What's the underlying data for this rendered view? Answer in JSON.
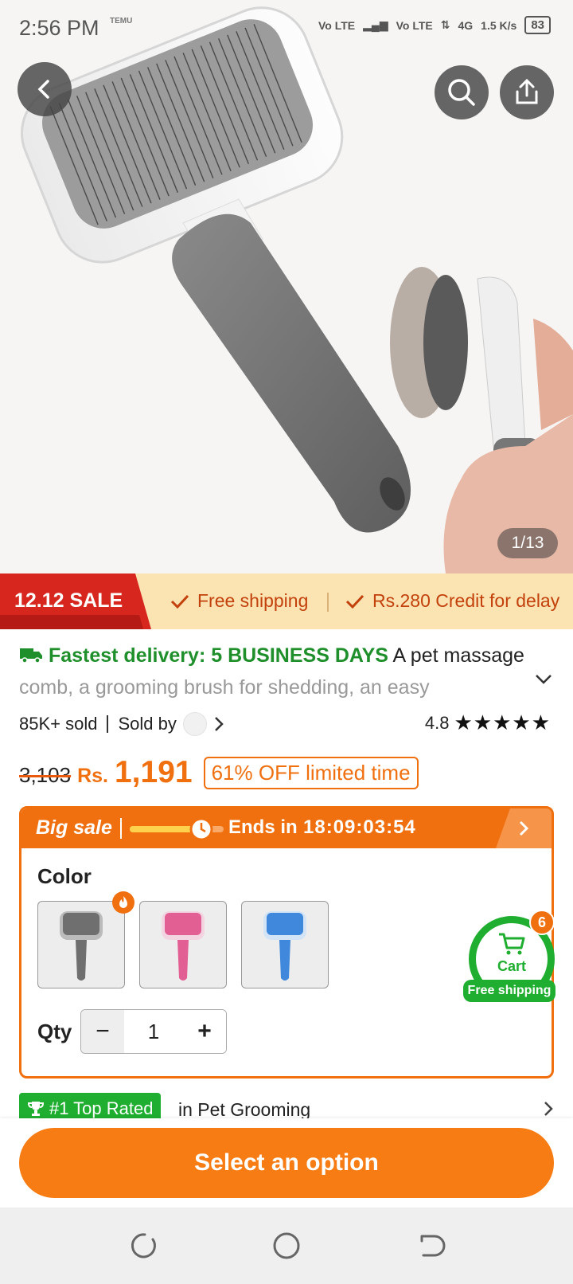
{
  "status_bar": {
    "time": "2:56 PM",
    "mini_label": "TEMU",
    "net1": "Vo LTE",
    "net2": "Vo LTE",
    "net3": "4G",
    "speed": "1.5 K/s",
    "battery": "83"
  },
  "gallery": {
    "counter": "1/13"
  },
  "promo_strip": {
    "sale_label": "12.12 SALE",
    "benefit1": "Free shipping",
    "benefit2": "Rs.280 Credit for delay"
  },
  "product": {
    "delivery": "Fastest delivery: 5 BUSINESS DAYS",
    "title_line1": " A pet massage",
    "title_line2": "comb, a grooming brush for shedding, an easy",
    "sold": "85K+ sold",
    "sold_by": "Sold by",
    "rating": "4.8",
    "stars": "★★★★★",
    "old_price": "3,103",
    "currency": "Rs.",
    "price": "1,191",
    "discount": "61% OFF limited time"
  },
  "big_sale": {
    "label": "Big sale",
    "progress": 0.75,
    "ends_label": "Ends in",
    "countdown": "18:09:03:54",
    "color_label": "Color",
    "swatch_colors": [
      "#6f6f6f",
      "#e25f94",
      "#3f88db"
    ],
    "qty_label": "Qty",
    "qty_value": "1",
    "minus": "−",
    "plus": "+"
  },
  "cart": {
    "label": "Cart",
    "count": "6",
    "shipping": "Free shipping"
  },
  "rank": {
    "badge": "#1 Top Rated",
    "category": "in Pet Grooming"
  },
  "cta": {
    "label": "Select an option"
  },
  "colors": {
    "accent": "#f0700f",
    "green": "#1fae2f"
  }
}
